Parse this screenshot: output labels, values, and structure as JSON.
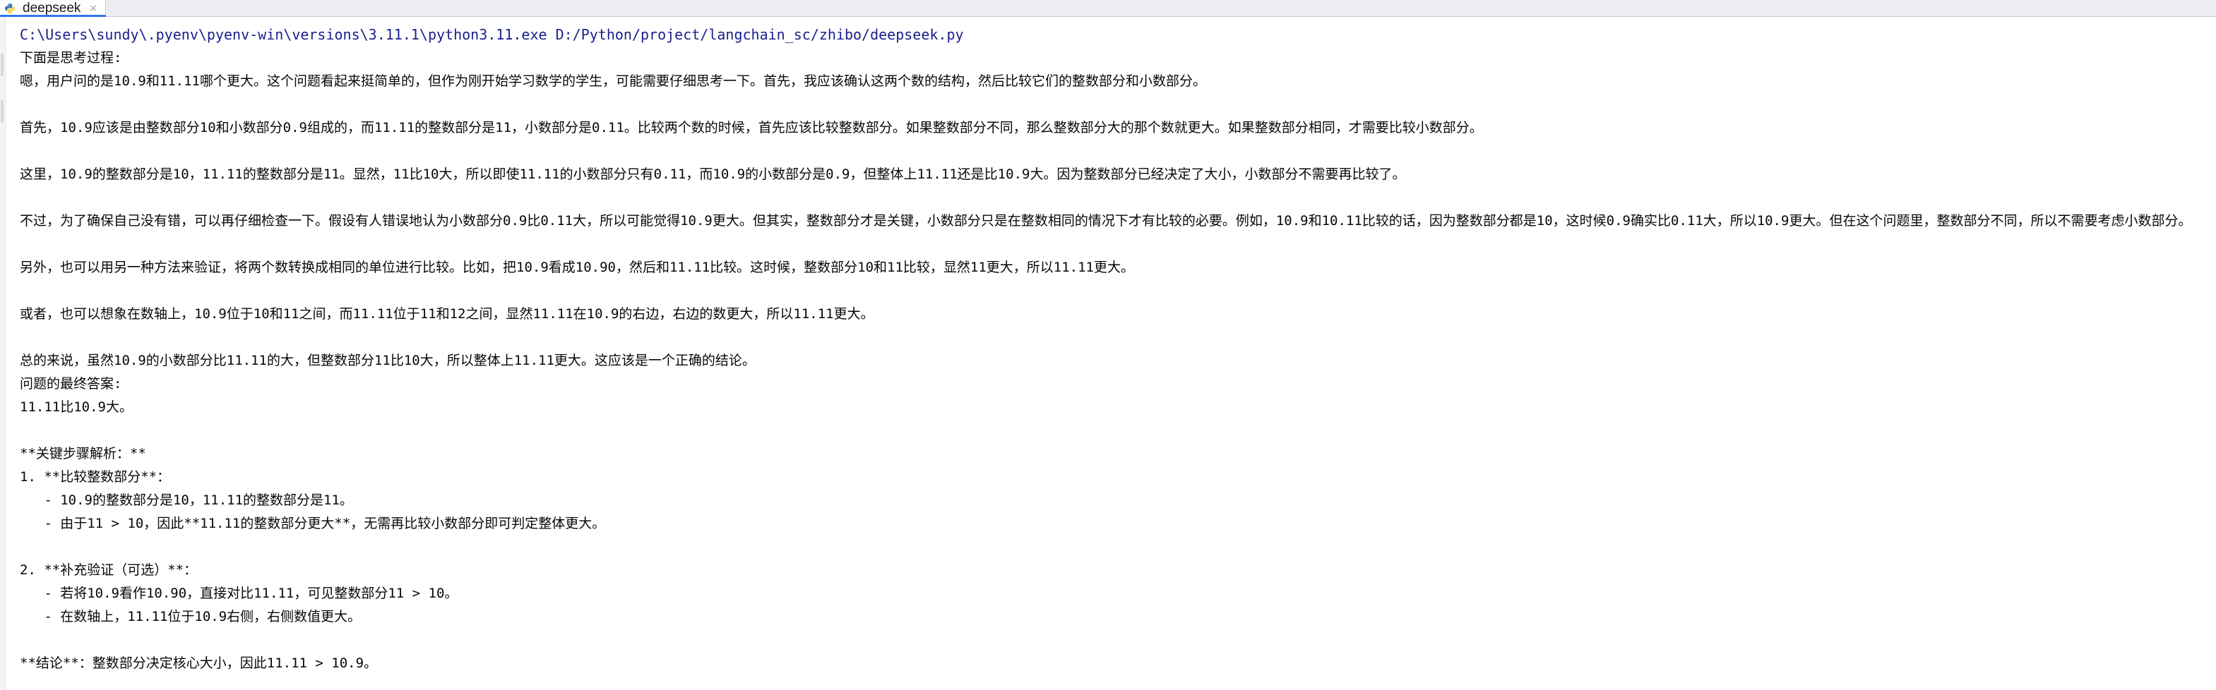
{
  "tab": {
    "title": "deepseek",
    "close_glyph": "×",
    "icon": "python-file-icon"
  },
  "console": {
    "command": "C:\\Users\\sundy\\.pyenv\\pyenv-win\\versions\\3.11.1\\python3.11.exe D:/Python/project/langchain_sc/zhibo/deepseek.py",
    "lines": [
      "下面是思考过程:",
      "嗯，用户问的是10.9和11.11哪个更大。这个问题看起来挺简单的，但作为刚开始学习数学的学生，可能需要仔细思考一下。首先，我应该确认这两个数的结构，然后比较它们的整数部分和小数部分。",
      "",
      "首先，10.9应该是由整数部分10和小数部分0.9组成的，而11.11的整数部分是11，小数部分是0.11。比较两个数的时候，首先应该比较整数部分。如果整数部分不同，那么整数部分大的那个数就更大。如果整数部分相同，才需要比较小数部分。",
      "",
      "这里，10.9的整数部分是10，11.11的整数部分是11。显然，11比10大，所以即使11.11的小数部分只有0.11，而10.9的小数部分是0.9，但整体上11.11还是比10.9大。因为整数部分已经决定了大小，小数部分不需要再比较了。",
      "",
      "不过，为了确保自己没有错，可以再仔细检查一下。假设有人错误地认为小数部分0.9比0.11大，所以可能觉得10.9更大。但其实，整数部分才是关键，小数部分只是在整数相同的情况下才有比较的必要。例如，10.9和10.11比较的话，因为整数部分都是10，这时候0.9确实比0.11大，所以10.9更大。但在这个问题里，整数部分不同，所以不需要考虑小数部分。",
      "",
      "另外，也可以用另一种方法来验证，将两个数转换成相同的单位进行比较。比如，把10.9看成10.90，然后和11.11比较。这时候，整数部分10和11比较，显然11更大，所以11.11更大。",
      "",
      "或者，也可以想象在数轴上，10.9位于10和11之间，而11.11位于11和12之间，显然11.11在10.9的右边，右边的数更大，所以11.11更大。",
      "",
      "总的来说，虽然10.9的小数部分比11.11的大，但整数部分11比10大，所以整体上11.11更大。这应该是一个正确的结论。",
      "问题的最终答案:",
      "11.11比10.9大。",
      "",
      "**关键步骤解析：**",
      "1. **比较整数部分**：",
      "   - 10.9的整数部分是10，11.11的整数部分是11。",
      "   - 由于11 > 10，因此**11.11的整数部分更大**，无需再比较小数部分即可判定整体更大。",
      "",
      "2. **补充验证（可选）**：",
      "   - 若将10.9看作10.90，直接对比11.11，可见整数部分11 > 10。",
      "   - 在数轴上，11.11位于10.9右侧，右侧数值更大。",
      "",
      "**结论**：整数部分决定核心大小，因此11.11 > 10.9。"
    ]
  },
  "colors": {
    "command_text": "#1a1f8c",
    "output_text": "#080808",
    "tab_active_underline": "#3574f0",
    "tabbar_bg": "#ebedf2"
  }
}
